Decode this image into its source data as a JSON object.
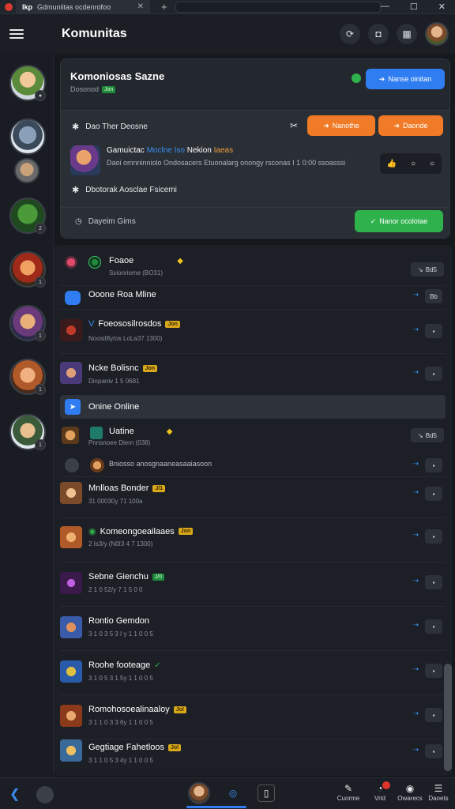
{
  "titlebar": {
    "tab_app": "Ikp",
    "tab_title": "Gdmuniitas ocdenrofoo",
    "close": "✕",
    "new_tab": "+",
    "min": "—",
    "max": "☐",
    "win_close": "✕"
  },
  "header": {
    "title": "Komunitas"
  },
  "card": {
    "title": "Komoniosas Sazne",
    "sub": "Dosonod",
    "sub_tag": "Jon",
    "primary_button": "Nanse oinitan",
    "inner": {
      "row1_label": "Dao Ther Deosne",
      "button_a": "Nanothe",
      "button_b": "Daonde",
      "post_head_prefix": "Gamuictac",
      "post_head_hl": "Moclne Iso",
      "post_head_mid": "Nekion",
      "post_head_hl2": "Iaeas",
      "post_body": "Daoi omnninniolo Ondosacers Etuonalarg onongy rsconas I 1 0:00 ssoasssi",
      "row3_label": "Dbotorak Aosclae Fsicemi",
      "row4_label": "Dayeim Gims",
      "green_button": "Nanor ocolotae"
    }
  },
  "list": {
    "items": [
      {
        "name": "Foaoe",
        "meta": "Ssionriome (BO31)",
        "action": "Bd5"
      },
      {
        "name": "Ooone Roa Mline",
        "meta": "",
        "action": "Bb"
      },
      {
        "name": "Foeososilrosdos",
        "tag": "Jon",
        "meta": "Noosit8y/os LoLa37 1300)",
        "action": "▪"
      },
      {
        "name": "Ncke Bolisnc",
        "tag": "Jon",
        "meta": "Diopaniv 1 5 0681",
        "action": "▪"
      },
      {
        "name": "Onine Online",
        "meta": "",
        "action": ""
      },
      {
        "name": "Uatine",
        "meta": "Pnnsnoee Diern (038)",
        "action": "Bd5"
      },
      {
        "name": "Bniosso anosgnaaneasaaiasoon",
        "meta": "",
        "action": "▪"
      },
      {
        "name": "Mnlloas Bonder",
        "tag": "J/1",
        "meta": "31 00030y 71 100a",
        "action": "▪"
      },
      {
        "name": "Komeongoeailaaes",
        "tag": "Jon",
        "meta": "2 Is3/y (N0I3 4 7 1300)",
        "action": "▪"
      },
      {
        "name": "Sebne Gienchu",
        "tag": "J/0",
        "meta": "2 1 0 52/y 7 1 5 0 0",
        "action": "▪"
      },
      {
        "name": "Rontio Gemdon",
        "meta": "3 1 0 3 5 3 I y 1 1 0 0 5",
        "action": "▪"
      },
      {
        "name": "Roohe footeage",
        "tag": "✓",
        "meta": "3 1 0 5 3 1 5y 1 1 0 0 5",
        "action": "▪"
      },
      {
        "name": "Romohosoealinaaloy",
        "tag": "Jol",
        "meta": "3 1 1 0 3 3 6y 1 1 0 0 5",
        "action": "▪"
      },
      {
        "name": "Gegtiage Fahetloos",
        "tag": "Jol",
        "meta": "3 1 1 0 5 3 4y 1 1 0 0 5",
        "action": "▪"
      }
    ]
  },
  "bottombar": {
    "tabs": [
      "Cuorme",
      "Vrid",
      "Owarecs",
      "Daoets"
    ]
  },
  "colors": {
    "accent_blue": "#2f7df0",
    "accent_orange": "#f07a25",
    "accent_green": "#2fb24c"
  }
}
